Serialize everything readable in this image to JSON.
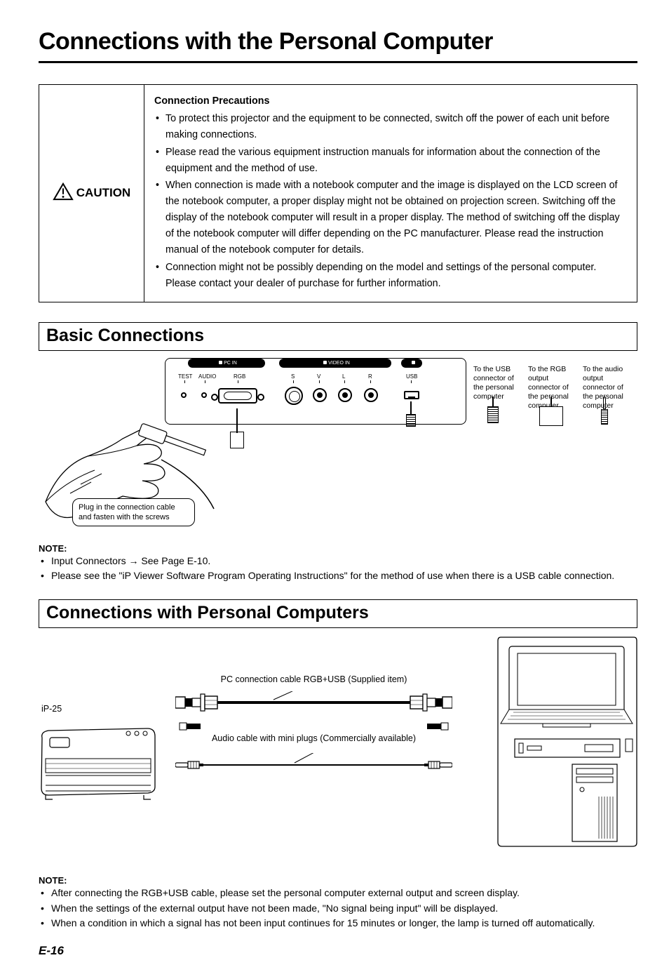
{
  "title": "Connections with the Personal Computer",
  "caution": {
    "label": "CAUTION",
    "heading": "Connection Precautions",
    "items": [
      "To protect this projector and the equipment to be connected, switch off the power of each unit before making connections.",
      "Please read the various equipment instruction manuals for information about the connection of the equipment and the method of use.",
      "When connection is made with a notebook computer and the image is displayed on the LCD screen of the notebook computer, a proper display might not be obtained on projection screen. Switching off the display of the notebook computer will result in a proper display. The method of switching off the display of the notebook computer will differ depending on the PC manufacturer. Please read the instruction manual of the notebook computer for details.",
      "Connection might not be possibly depending on the model and settings of the personal computer. Please contact your dealer of purchase for further information."
    ]
  },
  "section1": {
    "title": "Basic Connections",
    "panel_groups": {
      "pcin": "PC IN",
      "videoin": "VIDEO IN",
      "usbicon": ""
    },
    "ports": {
      "test": "TEST",
      "audio": "AUDIO",
      "rgb": "RGB",
      "s": "S",
      "v": "V",
      "l": "L",
      "r": "R",
      "usb": "USB"
    },
    "right_labels": [
      "To the USB connector of the personal computer",
      "To the RGB output connector of the personal computer",
      "To the audio output connector of the personal computer"
    ],
    "plug_label": "Plug in the connection cable and fasten with the screws",
    "note_heading": "NOTE:",
    "notes": [
      "Input Connectors → See Page E-10.",
      "Please see the \"iP Viewer Software Program Operating Instructions\" for the method of use when there is a USB cable connection."
    ]
  },
  "section2": {
    "title": "Connections with Personal Computers",
    "projector_model": "iP-25",
    "cable1": "PC connection cable RGB+USB (Supplied item)",
    "cable2": "Audio cable with mini plugs (Commercially available)",
    "note_heading": "NOTE:",
    "notes": [
      "After connecting the RGB+USB cable, please set the personal computer external output and screen display.",
      "When the settings of the external output have not been made, \"No signal being input\" will be displayed.",
      "When a condition in which a signal has not been input continues for 15 minutes or longer, the lamp is turned off automatically."
    ]
  },
  "page_number": "E-16"
}
